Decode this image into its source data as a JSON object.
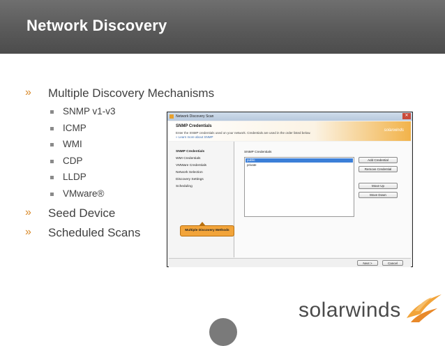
{
  "slide": {
    "title": "Network Discovery",
    "bullets": [
      {
        "label": "Multiple Discovery Mechanisms",
        "subitems": [
          "SNMP v1-v3",
          "ICMP",
          "WMI",
          "CDP",
          "LLDP",
          "VMware®"
        ]
      },
      {
        "label": "Seed Device"
      },
      {
        "label": "Scheduled Scans"
      }
    ],
    "bullet_marker": "»",
    "brand_text": "solarwinds"
  },
  "dialog": {
    "window_title": "Network Discovery Scan",
    "close_glyph": "✕",
    "header_title": "SNMP Credentials",
    "header_subtitle": "Enter the SNMP credentials used on your network. Credentials are used in the order listed below.",
    "header_link": "» Learn more about SNMP",
    "header_logo": "solarwinds",
    "nav": [
      "SNMP Credentials",
      "WMI Credentials",
      "VMWare Credentials",
      "Network Selection",
      "Discovery Settings",
      "Scheduling"
    ],
    "callout": "Multiple Discovery Methods",
    "cred_label": "SNMP Credentials",
    "credentials": [
      "public",
      "private"
    ],
    "buttons": {
      "add": "Add Credential",
      "remove": "Remove Credential",
      "up": "Move Up",
      "down": "Move Down"
    },
    "footer": {
      "next": "Next >",
      "cancel": "Cancel"
    }
  },
  "colors": {
    "accent": "#d98a2a",
    "header_bg": "#5a5a5a",
    "callout": "#f2a43a",
    "selection": "#3c7fd8"
  }
}
